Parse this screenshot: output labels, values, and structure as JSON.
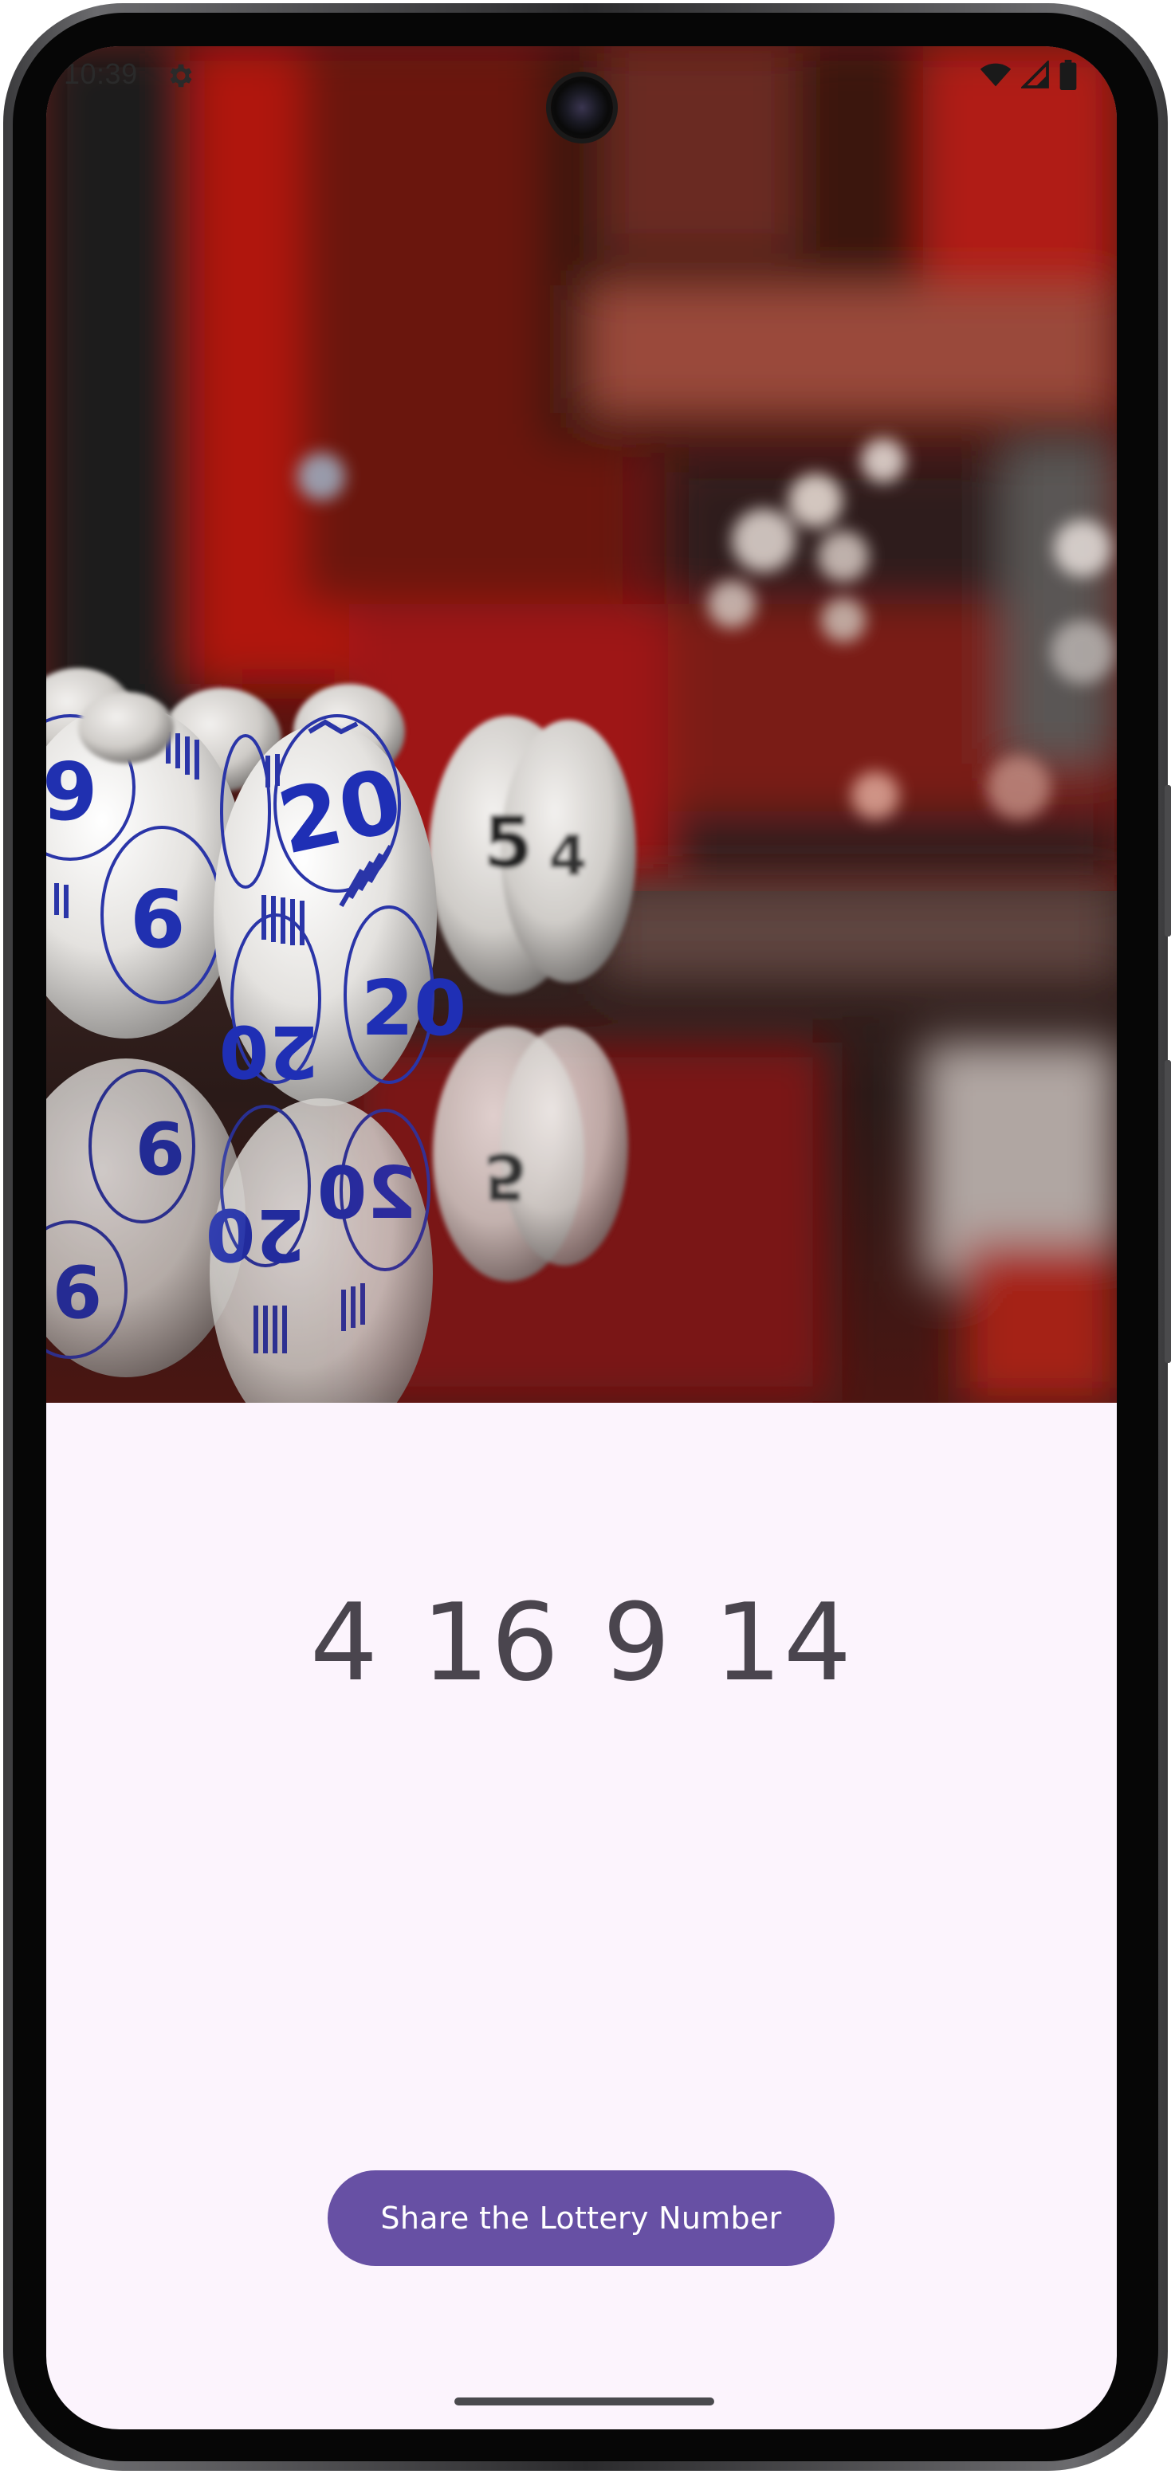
{
  "status_bar": {
    "time": "10:39",
    "icons": [
      "settings-gear-icon",
      "wifi-icon",
      "cellular-signal-icon",
      "battery-icon"
    ]
  },
  "hero_image": {
    "subject": "lottery-balls-photo",
    "balls": [
      "9",
      "9",
      "20",
      "20",
      "20"
    ]
  },
  "main": {
    "lottery_number": "4 16 9 14",
    "share_button_label": "Share the Lottery Number"
  },
  "colors": {
    "background": "#fcf4fd",
    "button": "#6750a4",
    "button_text": "#ffffff",
    "number_text": "#4a454e"
  }
}
